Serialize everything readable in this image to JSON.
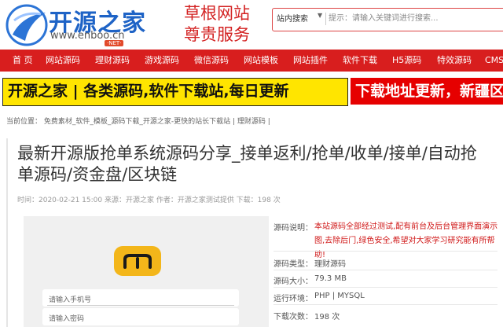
{
  "header": {
    "logo_text": "开源之家",
    "logo_url": "www.enboo.cn",
    "logo_badge": "·NET·",
    "slogan_line1": "草根网站",
    "slogan_line2": "尊贵服务"
  },
  "search": {
    "category": "站内搜索",
    "placeholder": "提示：请输入关键词进行搜索..."
  },
  "nav": {
    "items": [
      "首 页",
      "网站源码",
      "理财源码",
      "游戏源码",
      "微信源码",
      "网站模板",
      "网站插件",
      "软件下载",
      "H5源码",
      "特效源码",
      "CMS"
    ]
  },
  "banners": {
    "yellow": "开源之家 | 各类源码,软件下载站,每日更新",
    "red": "下载地址更新，新疆区"
  },
  "breadcrumb": "当前位置： 免费素材_软件_模板_源码下载_开源之家-更快的站长下载站 | 理财源码 |",
  "article": {
    "title": "最新开源版抢单系统源码分享_接单返利/抢单/收单/接单/自动抢单源码/资金盘/区块链",
    "meta": "时间：2020-02-21 15:00 来源：开源之家 作者：开源之家测试提供 下载：198 次"
  },
  "preview": {
    "field1": "请输入手机号",
    "field2": "请输入密码"
  },
  "info": {
    "desc_label": "源码说明：",
    "desc_text": "本站源码全部经过测试,配有前台及后台管理界面演示图,去除后门,绿色安全,希望对大家学习研究能有所帮助!",
    "type_label": "源码类型：",
    "type_value": "理财源码",
    "size_label": "源码大小：",
    "size_value": "79.3 MB",
    "env_label": "运行环境：",
    "env_value": "PHP | MYSQL",
    "downloads_label": "下载次数：",
    "downloads_value": "198 次"
  },
  "colors": {
    "brand_red": "#d81e1e",
    "brand_blue": "#1e63c6",
    "banner_yellow": "#ffe500",
    "app_icon": "#f3b61a"
  }
}
